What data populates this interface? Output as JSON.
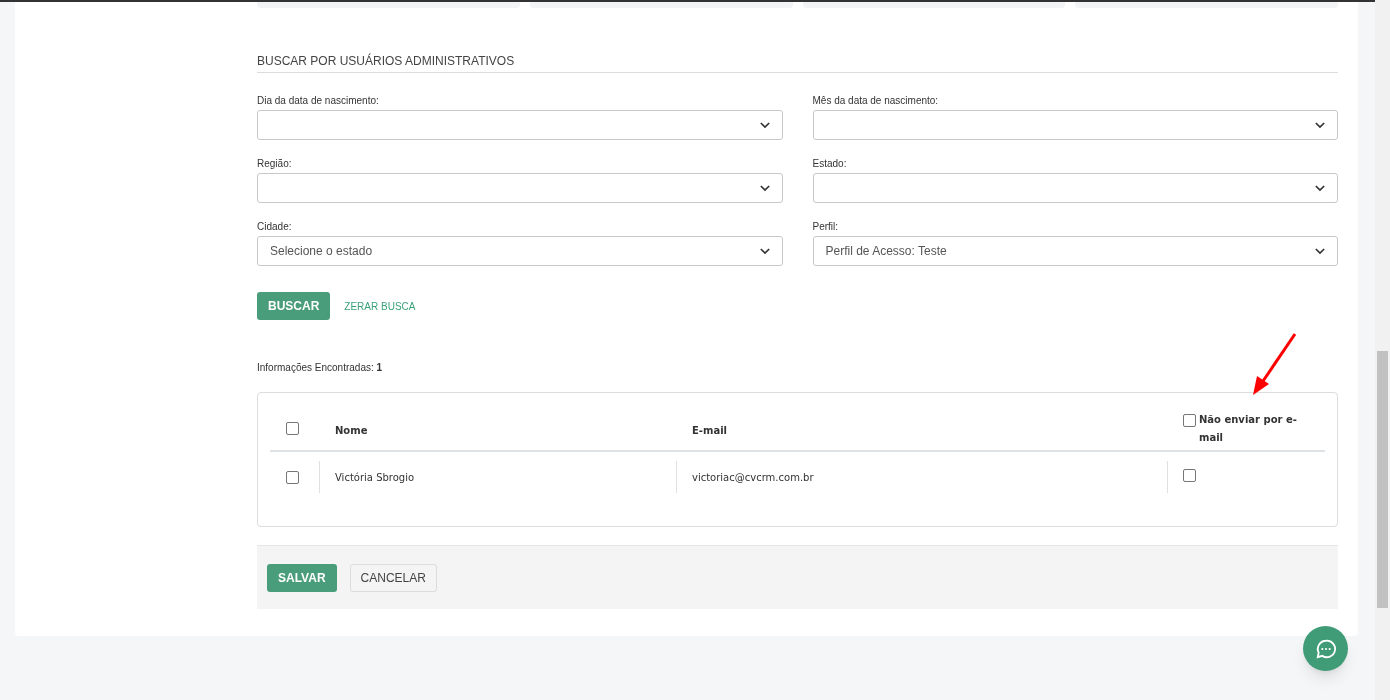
{
  "section_title": "BUSCAR POR USUÁRIOS ADMINISTRATIVOS",
  "fields": [
    {
      "label": "Dia da data de nascimento:"
    },
    {
      "label": "Mês da data de nascimento:"
    },
    {
      "label": "Região:"
    },
    {
      "label": "Estado:"
    },
    {
      "label": "Cidade:",
      "value": "Selecione o estado"
    },
    {
      "label": "Perfil:",
      "value": "Perfil de Acesso: Teste"
    }
  ],
  "search_button": "BUSCAR",
  "reset_link": "ZERAR BUSCA",
  "results": {
    "label": "Informações Encontradas:",
    "count": "1"
  },
  "table": {
    "select_all_checked": false,
    "columns": [
      "Nome",
      "E-mail"
    ],
    "no_email_header": {
      "label": "Não enviar por e-mail",
      "checked": false
    },
    "rows": [
      {
        "checked": false,
        "name": "Victória Sbrogio",
        "email": "victoriac@cvcrm.com.br",
        "no_email": false
      }
    ]
  },
  "buttons": {
    "save": "SALVAR",
    "cancel": "CANCELAR"
  }
}
